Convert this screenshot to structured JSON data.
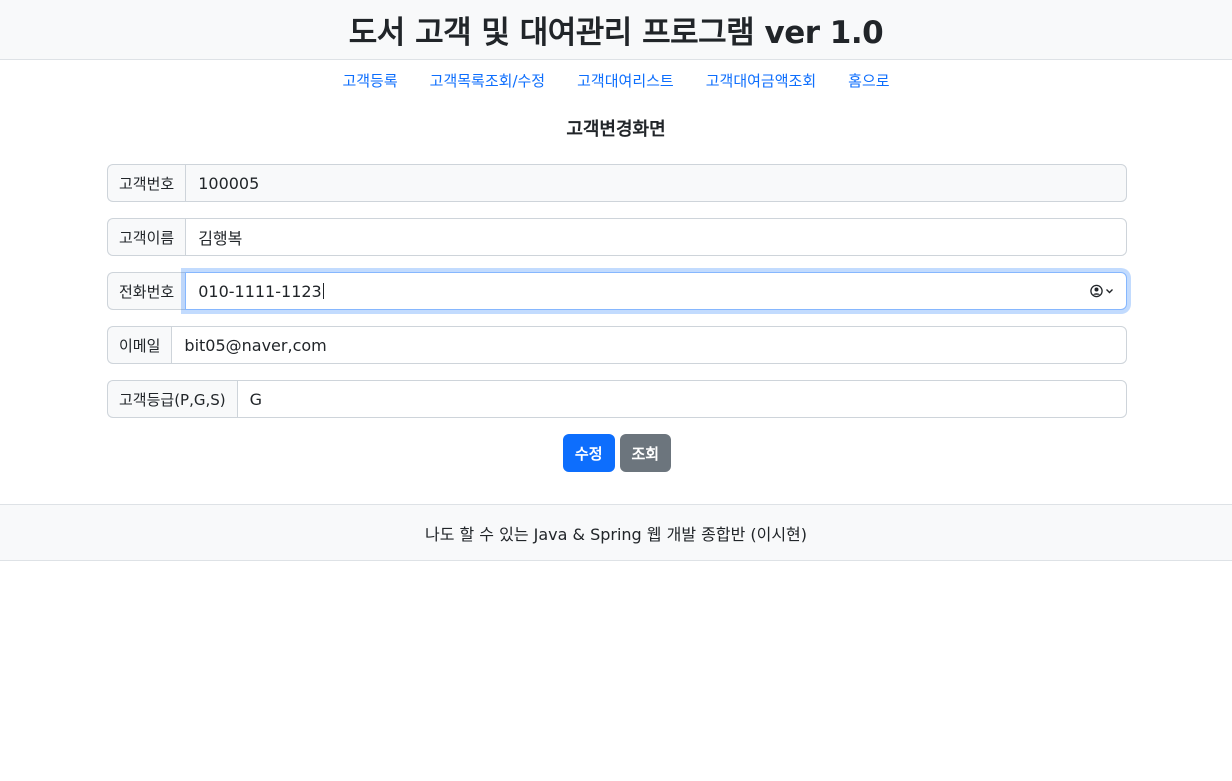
{
  "header": {
    "title": "도서 고객 및 대여관리 프로그램 ver 1.0"
  },
  "nav": {
    "items": [
      {
        "label": "고객등록"
      },
      {
        "label": "고객목록조회/수정"
      },
      {
        "label": "고객대여리스트"
      },
      {
        "label": "고객대여금액조회"
      },
      {
        "label": "홈으로"
      }
    ]
  },
  "page": {
    "title": "고객변경화면"
  },
  "form": {
    "fields": [
      {
        "label": "고객번호",
        "value": "100005"
      },
      {
        "label": "고객이름",
        "value": "김행복"
      },
      {
        "label": "전화번호",
        "value": "010-1111-1123"
      },
      {
        "label": "이메일",
        "value": "bit05@naver,com"
      },
      {
        "label": "고객등급(P,G,S)",
        "value": "G"
      }
    ]
  },
  "buttons": {
    "update_label": "수정",
    "search_label": "조회"
  },
  "colors": {
    "primary": "#0d6efd",
    "secondary": "#6c757d",
    "link": "#0d6efd"
  },
  "icons": {
    "autofill": "contact-autofill-icon"
  },
  "footer": {
    "text": "나도 할 수 있는 Java & Spring 웹 개발 종합반 (이시현)"
  }
}
